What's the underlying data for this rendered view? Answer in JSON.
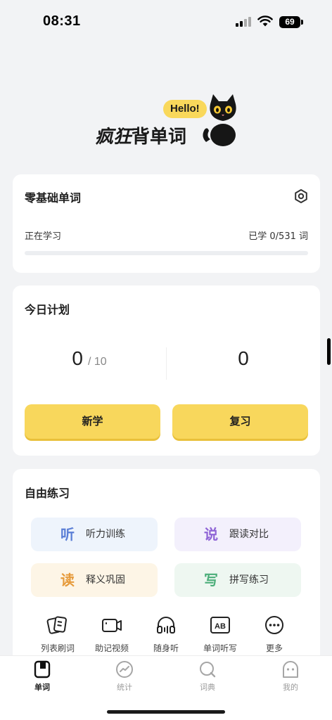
{
  "status_bar": {
    "time": "08:31",
    "battery": "69"
  },
  "hero": {
    "hello": "Hello!",
    "logo_strong": "疯狂",
    "logo_rest": "背单词"
  },
  "book_card": {
    "title": "零基础单词",
    "learning_label": "正在学习",
    "learned_count": "已学 0/531 词",
    "progress": 0
  },
  "plan_card": {
    "title": "今日计划",
    "new_count": "0",
    "new_target": "/ 10",
    "review_count": "0",
    "new_button": "新学",
    "review_button": "复习"
  },
  "practice_card": {
    "title": "自由练习",
    "modes": [
      {
        "glyph": "听",
        "label": "听力训练"
      },
      {
        "glyph": "说",
        "label": "跟读对比"
      },
      {
        "glyph": "读",
        "label": "释义巩固"
      },
      {
        "glyph": "写",
        "label": "拼写练习"
      }
    ],
    "tools": [
      {
        "label": "列表刷词",
        "icon": "cards-icon"
      },
      {
        "label": "助记视频",
        "icon": "video-camera-icon"
      },
      {
        "label": "随身听",
        "icon": "headphones-icon"
      },
      {
        "label": "单词听写",
        "icon": "ab-box-icon"
      },
      {
        "label": "更多",
        "icon": "more-icon"
      }
    ]
  },
  "tab_bar": {
    "tabs": [
      {
        "label": "单词",
        "icon": "book-icon",
        "active": true
      },
      {
        "label": "统计",
        "icon": "chart-icon",
        "active": false
      },
      {
        "label": "词典",
        "icon": "search-icon",
        "active": false
      },
      {
        "label": "我的",
        "icon": "profile-icon",
        "active": false
      }
    ]
  },
  "colors": {
    "accent_yellow": "#f8d75c",
    "background": "#f2f3f5",
    "listen": "#5b7fd6",
    "speak": "#8f64d6",
    "read": "#e69a3a",
    "write": "#4cae7a"
  }
}
